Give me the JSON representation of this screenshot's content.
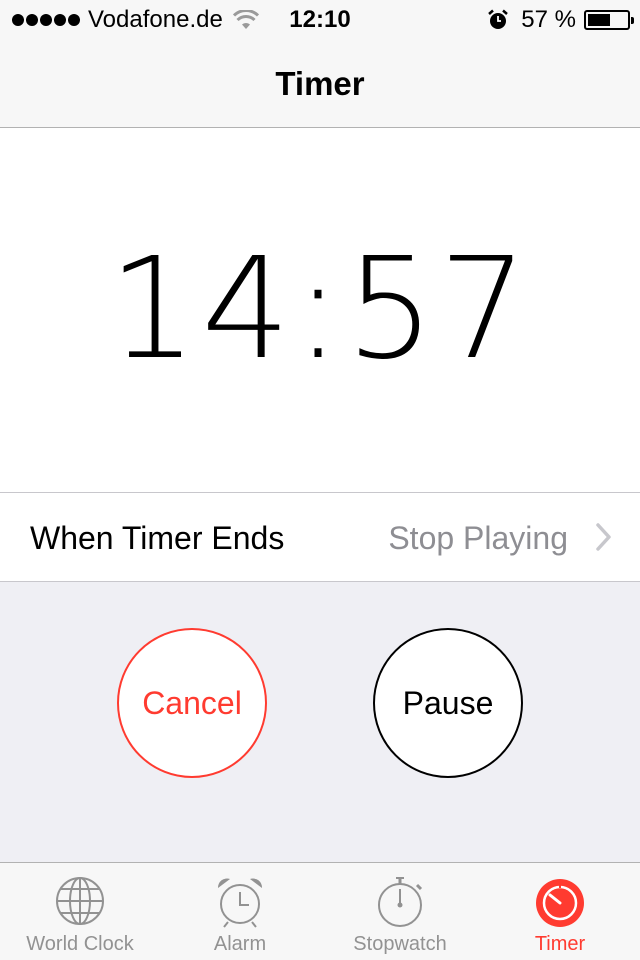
{
  "status_bar": {
    "carrier": "Vodafone.de",
    "time": "12:10",
    "battery_percent": "57 %",
    "battery_level": 0.57,
    "signal_icon": "signal-dots-icon",
    "wifi_icon": "wifi-icon",
    "alarm_icon": "alarm-clock-icon",
    "battery_icon": "battery-icon"
  },
  "nav": {
    "title": "Timer"
  },
  "timer": {
    "display": "14:57"
  },
  "when_timer_ends": {
    "label": "When Timer Ends",
    "value": "Stop Playing",
    "icon": "chevron-right-icon"
  },
  "buttons": {
    "cancel_label": "Cancel",
    "pause_label": "Pause"
  },
  "tabs": [
    {
      "label": "World Clock",
      "icon": "globe-icon",
      "active": false
    },
    {
      "label": "Alarm",
      "icon": "alarm-clock-icon",
      "active": false
    },
    {
      "label": "Stopwatch",
      "icon": "stopwatch-icon",
      "active": false
    },
    {
      "label": "Timer",
      "icon": "timer-icon",
      "active": true
    }
  ],
  "colors": {
    "accent": "#ff3b30",
    "secondary_text": "#8e8e93",
    "tab_inactive": "#929292",
    "bar_background": "#f7f7f7",
    "button_area_background": "#efeff4"
  }
}
